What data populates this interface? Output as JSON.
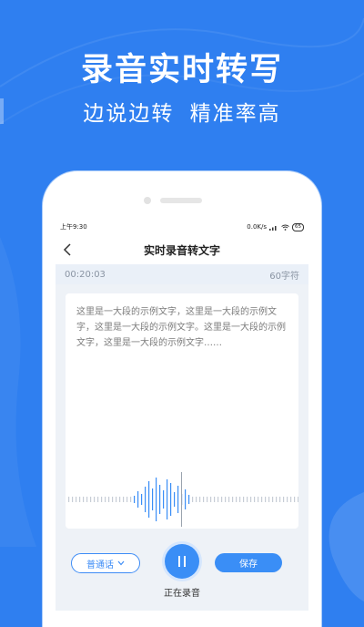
{
  "hero": {
    "title": "录音实时转写",
    "subtitle": "边说边转  精准率高"
  },
  "statusbar": {
    "time": "上午9:30",
    "network": "0.0K/s",
    "battery": "65"
  },
  "navbar": {
    "title": "实时录音转文字"
  },
  "info": {
    "duration": "00:20:03",
    "char_count": "60字符"
  },
  "transcript": {
    "text": "这里是一大段的示例文字，这里是一大段的示例文字，这里是一大段的示例文字。这里是一大段的示例文字，这里是一大段的示例文字……"
  },
  "controls": {
    "language_label": "普通话",
    "recording_status": "正在录音",
    "save_label": "保存"
  },
  "colors": {
    "background": "#2f7ff0",
    "accent": "#3a8ef6",
    "panel": "#eef2f7"
  }
}
